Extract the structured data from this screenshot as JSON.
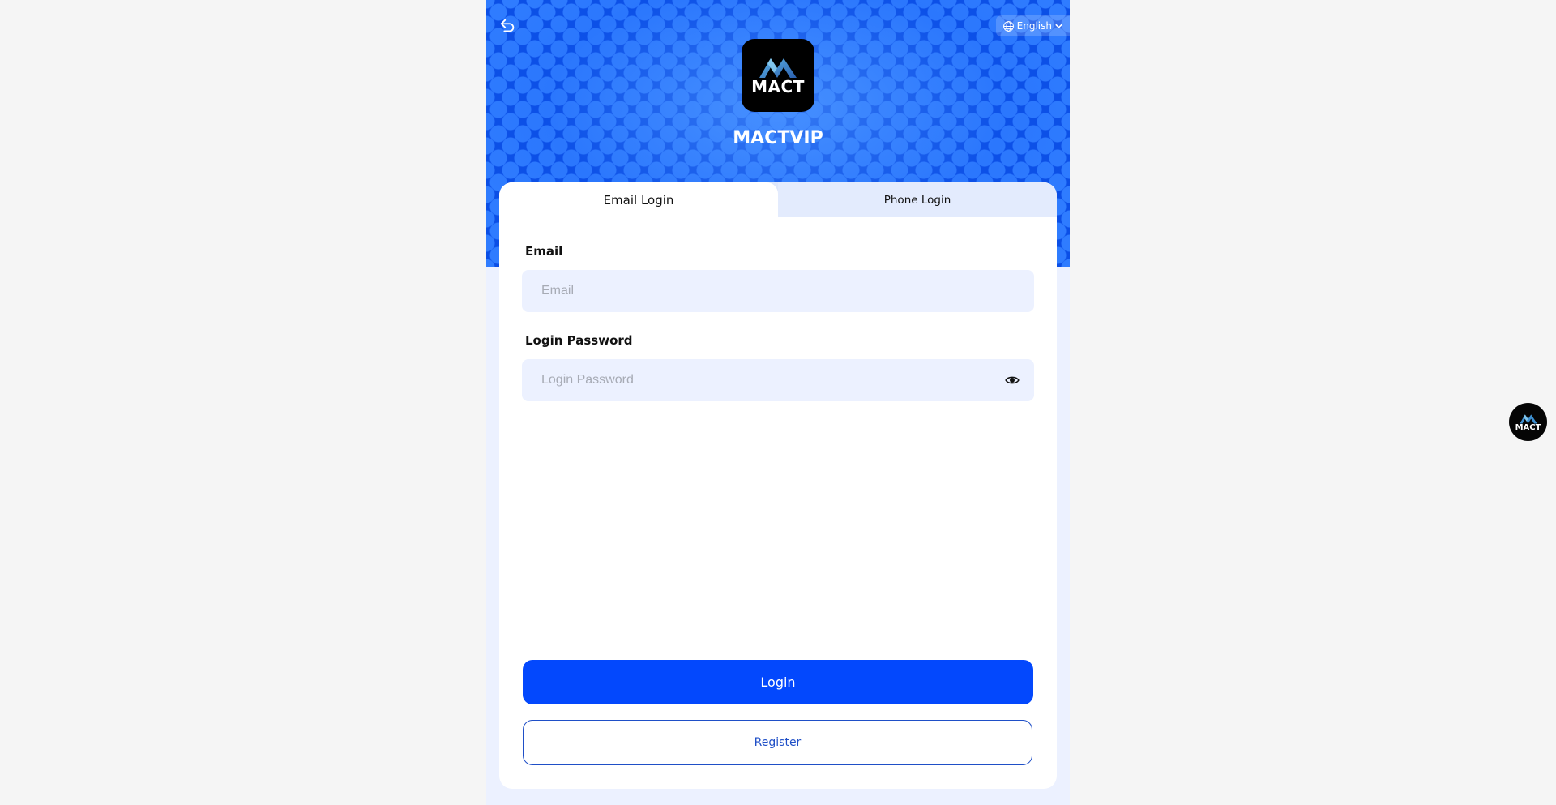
{
  "header": {
    "back_icon": "back-arrow-icon",
    "language": {
      "icon": "globe-icon",
      "label": "English",
      "chevron_icon": "chevron-down-icon"
    },
    "logo_text": "MACT",
    "brand_name": "MACTVIP"
  },
  "tabs": [
    {
      "label": "Email Login",
      "active": true
    },
    {
      "label": "Phone Login",
      "active": false
    }
  ],
  "form": {
    "email": {
      "label": "Email",
      "placeholder": "Email",
      "value": ""
    },
    "password": {
      "label": "Login Password",
      "placeholder": "Login Password",
      "value": "",
      "toggle_icon": "eye-icon"
    },
    "login_label": "Login",
    "register_label": "Register"
  },
  "floating_logo_text": "MACT",
  "colors": {
    "primary": "#0348fd",
    "hero_blue": "#0b4fe6",
    "field_bg": "#ecf1ff",
    "register_border": "#1f4fc7"
  }
}
